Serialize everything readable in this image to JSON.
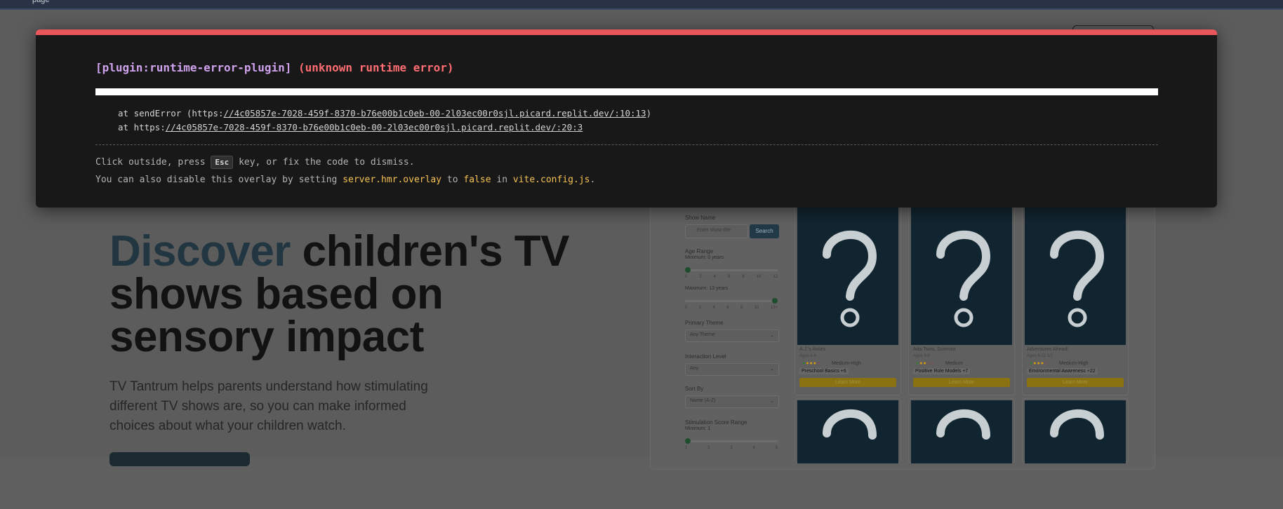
{
  "topbar": {
    "hint": "page"
  },
  "hero": {
    "title_accent": "Discover",
    "title_rest": " children's TV shows based on sensory impact",
    "description": "TV Tantrum helps parents understand how stimulating different TV shows are, so you can make informed choices about what your children watch."
  },
  "filters": {
    "show_name_label": "Show Name",
    "search_placeholder": "Enter show title",
    "search_button": "Search",
    "age_range_label": "Age Range",
    "minimum_label": "Minimum: 0 years",
    "maximum_label": "Maximum: 13 years",
    "age_ticks": [
      "0",
      "2",
      "4",
      "6",
      "8",
      "10",
      "12"
    ],
    "age_ticks_max": [
      "0",
      "2",
      "4",
      "6",
      "8",
      "10",
      "13+"
    ],
    "primary_theme_label": "Primary Theme",
    "primary_theme_value": "Any Theme",
    "interaction_level_label": "Interaction Level",
    "interaction_level_value": "Any",
    "sort_by_label": "Sort By",
    "sort_by_value": "Name (A-Z)",
    "stimulation_label": "Stimulation Score Range",
    "stimulation_min_label": "Minimum: 1",
    "stimulation_ticks": [
      "1",
      "2",
      "3",
      "4",
      "5"
    ]
  },
  "cards": [
    {
      "name": "A.J.'s Aisles",
      "ages": "Ages 4-6",
      "level": "Medium-High",
      "tag": "Preschool Basics",
      "extra": "+6",
      "cta": "Learn More",
      "dot_colors": [
        "#2e7d32",
        "#d29b12",
        "#d29b12",
        "#d29b12",
        "#b23838"
      ]
    },
    {
      "name": "Ada Twist, Scientist",
      "ages": "Ages 4-8",
      "level": "Medium",
      "tag": "Positive Role Models",
      "extra": "+7",
      "cta": "Learn More",
      "dot_colors": [
        "#2e7d32",
        "#d29b12",
        "#d29b12",
        "#b23838",
        "#b23838"
      ]
    },
    {
      "name": "Adventures Ahead!",
      "ages": "Ages 6-11 1/2",
      "level": "Medium-High",
      "tag": "Environmental Awareness",
      "extra": "+22",
      "cta": "Learn More",
      "dot_colors": [
        "#2e7d32",
        "#d29b12",
        "#d29b12",
        "#d29b12",
        "#b23838"
      ]
    }
  ],
  "overlay": {
    "plugin": "[plugin:runtime-error-plugin]",
    "message": "(unknown runtime error)",
    "stack_1_prefix": "at sendError (https:",
    "stack_1_link": "//4c05857e-7028-459f-8370-b76e00b1c0eb-00-2l03ec00r0sjl.picard.replit.dev/:10:13",
    "stack_1_suffix": ")",
    "stack_2_prefix": "at https:",
    "stack_2_link": "//4c05857e-7028-459f-8370-b76e00b1c0eb-00-2l03ec00r0sjl.picard.replit.dev/:20:3",
    "tip_1_before": "Click outside, press ",
    "tip_1_key": "Esc",
    "tip_1_after": " key, or fix the code to dismiss.",
    "tip_2_a": "You can also disable this overlay by setting ",
    "tip_2_code1": "server.hmr.overlay",
    "tip_2_b": " to ",
    "tip_2_code2": "false",
    "tip_2_c": " in ",
    "tip_2_code3": "vite.config.js",
    "tip_2_d": "."
  },
  "colors": {
    "overlay_accent": "#e8555a",
    "plugin_text": "#cfa2ee",
    "error_text": "#ff6d72",
    "code_text": "#f4c152",
    "card_art_bg": "#112530",
    "cta_yellow": "#8a7112"
  }
}
